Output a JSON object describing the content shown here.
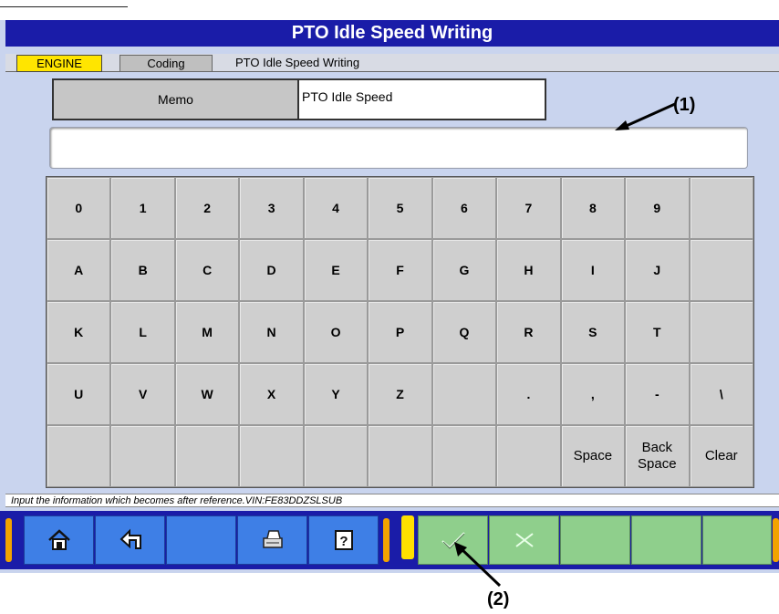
{
  "window": {
    "title": "PTO Idle Speed Writing"
  },
  "breadcrumb": {
    "items": [
      "ENGINE",
      "Coding",
      "PTO Idle Speed Writing"
    ]
  },
  "memo": {
    "label": "Memo",
    "value": "PTO Idle Speed"
  },
  "input": {
    "value": ""
  },
  "keyboard": {
    "rows": [
      [
        "0",
        "1",
        "2",
        "3",
        "4",
        "5",
        "6",
        "7",
        "8",
        "9",
        ""
      ],
      [
        "A",
        "B",
        "C",
        "D",
        "E",
        "F",
        "G",
        "H",
        "I",
        "J",
        ""
      ],
      [
        "K",
        "L",
        "M",
        "N",
        "O",
        "P",
        "Q",
        "R",
        "S",
        "T",
        ""
      ],
      [
        "U",
        "V",
        "W",
        "X",
        "Y",
        "Z",
        "",
        ".",
        ",",
        "-",
        "\\"
      ],
      [
        "",
        "",
        "",
        "",
        "",
        "",
        "",
        "",
        "Space",
        "Back Space",
        "Clear"
      ]
    ]
  },
  "status": {
    "text": "Input the information which becomes after reference.VIN:FE83DDZSLSUB"
  },
  "toolbar": {
    "left_icons": [
      "home-icon",
      "back-arrow-icon",
      "",
      "printer-icon",
      "help-icon"
    ],
    "right_icons": [
      "checkmark-icon",
      "cancel-x-icon",
      "",
      "",
      ""
    ],
    "colors": {
      "bar": "#1a1ca8",
      "blue_button": "#3e7fe6",
      "green_button": "#8fcf8c",
      "accent_yellow": "#ffe000",
      "accent_orange": "#f2a300"
    }
  },
  "annotations": {
    "callout_1": "(1)",
    "callout_2": "(2)"
  }
}
